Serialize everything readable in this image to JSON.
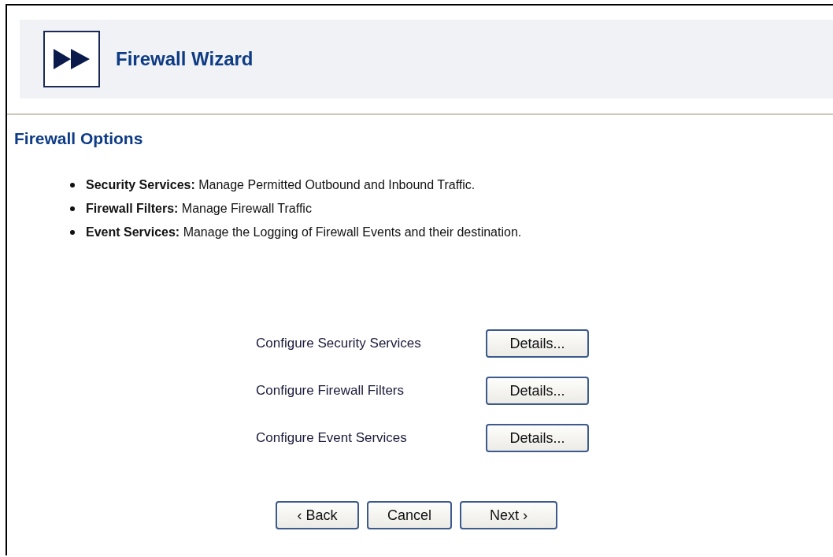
{
  "header": {
    "title": "Firewall Wizard"
  },
  "section": {
    "title": "Firewall Options"
  },
  "bullets": [
    {
      "text": "**Security Services:** Manage Permitted Outbound and Inbound Traffic."
    },
    {
      "text": "**Firewall Filters:** Manage Firewall Traffic"
    },
    {
      "text": "**Event Services:** Manage the Logging of Firewall Events and their destination."
    }
  ],
  "configure_rows": [
    {
      "label": "Configure Security Services",
      "button": "Details..."
    },
    {
      "label": "Configure Firewall Filters",
      "button": "Details..."
    },
    {
      "label": "Configure Event Services",
      "button": "Details..."
    }
  ],
  "nav_buttons": [
    "‹ Back",
    "Cancel",
    "Next ›"
  ]
}
